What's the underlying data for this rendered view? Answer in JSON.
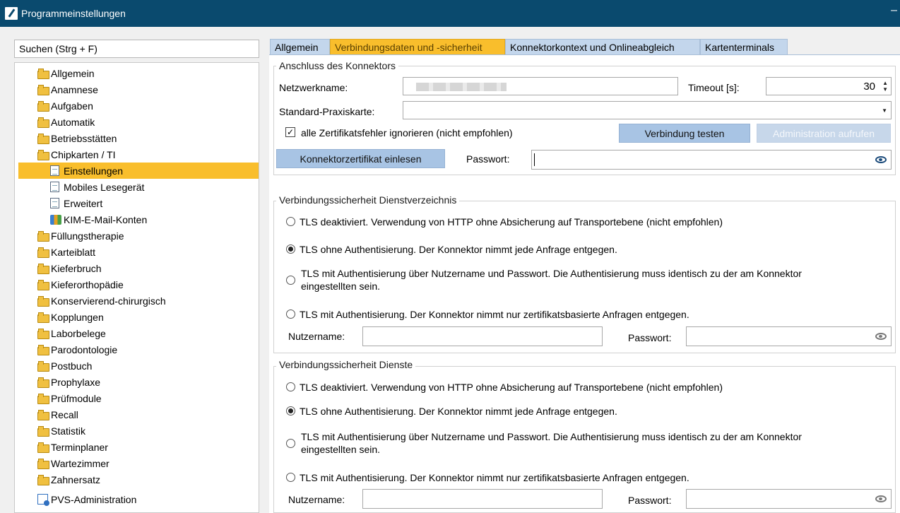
{
  "window": {
    "title": "Programmeinstellungen",
    "minimize_glyph": "–"
  },
  "search": {
    "placeholder": "Suchen (Strg + F)"
  },
  "tree": {
    "items": [
      {
        "label": "Allgemein",
        "icon": "folder-icon"
      },
      {
        "label": "Anamnese",
        "icon": "folder-icon"
      },
      {
        "label": "Aufgaben",
        "icon": "folder-icon"
      },
      {
        "label": "Automatik",
        "icon": "folder-icon"
      },
      {
        "label": "Betriebsstätten",
        "icon": "folder-icon"
      },
      {
        "label": "Chipkarten / TI",
        "icon": "folder-icon"
      },
      {
        "label": "Einstellungen",
        "icon": "document-icon",
        "selected": true
      },
      {
        "label": "Mobiles Lesegerät",
        "icon": "document-icon"
      },
      {
        "label": "Erweitert",
        "icon": "document-icon"
      },
      {
        "label": "KIM-E-Mail-Konten",
        "icon": "books-icon"
      },
      {
        "label": "Füllungstherapie",
        "icon": "folder-icon"
      },
      {
        "label": "Karteiblatt",
        "icon": "folder-icon"
      },
      {
        "label": "Kieferbruch",
        "icon": "folder-icon"
      },
      {
        "label": "Kieferorthopädie",
        "icon": "folder-icon"
      },
      {
        "label": "Konservierend-chirurgisch",
        "icon": "folder-icon"
      },
      {
        "label": "Kopplungen",
        "icon": "folder-icon"
      },
      {
        "label": "Laborbelege",
        "icon": "folder-icon"
      },
      {
        "label": "Parodontologie",
        "icon": "folder-icon"
      },
      {
        "label": "Postbuch",
        "icon": "folder-icon"
      },
      {
        "label": "Prophylaxe",
        "icon": "folder-icon"
      },
      {
        "label": "Prüfmodule",
        "icon": "folder-icon"
      },
      {
        "label": "Recall",
        "icon": "folder-icon"
      },
      {
        "label": "Statistik",
        "icon": "folder-icon"
      },
      {
        "label": "Terminplaner",
        "icon": "folder-icon"
      },
      {
        "label": "Wartezimmer",
        "icon": "folder-icon"
      },
      {
        "label": "Zahnersatz",
        "icon": "folder-icon"
      },
      {
        "label": "PVS-Administration",
        "icon": "pvs-icon"
      }
    ]
  },
  "tabs": [
    {
      "label": "Allgemein"
    },
    {
      "label": "Verbindungsdaten und -sicherheit",
      "active": true
    },
    {
      "label": "Konnektorkontext und Onlineabgleich"
    },
    {
      "label": "Kartenterminals"
    }
  ],
  "konnektor": {
    "title": "Anschluss des Konnektors",
    "netzwerkname_label": "Netzwerkname:",
    "timeout_label": "Timeout [s]:",
    "timeout_value": "30",
    "praxiskarte_label": "Standard-Praxiskarte:",
    "ignore_cert_label": "alle Zertifikatsfehler ignorieren (nicht empfohlen)",
    "ignore_cert_checked": true,
    "test_button": "Verbindung testen",
    "admin_button": "Administration aufrufen",
    "cert_button": "Konnektorzertifikat einlesen",
    "password_label": "Passwort:"
  },
  "dienstverzeichnis": {
    "title": "Verbindungssicherheit Dienstverzeichnis",
    "options": [
      "TLS deaktiviert. Verwendung von HTTP ohne Absicherung auf Transportebene (nicht empfohlen)",
      "TLS ohne Authentisierung. Der Konnektor nimmt jede Anfrage entgegen.",
      "TLS mit Authentisierung über Nutzername und Passwort. Die Authentisierung muss identisch zu der am Konnektor",
      "eingestellten sein.",
      "TLS mit Authentisierung. Der Konnektor nimmt nur zertifikatsbasierte Anfragen entgegen."
    ],
    "selected_index": 1,
    "username_label": "Nutzername:",
    "password_label": "Passwort:"
  },
  "dienste": {
    "title": "Verbindungssicherheit Dienste",
    "options": [
      "TLS deaktiviert. Verwendung von HTTP ohne Absicherung auf Transportebene (nicht empfohlen)",
      "TLS ohne Authentisierung. Der Konnektor nimmt jede Anfrage entgegen.",
      "TLS mit Authentisierung über Nutzername und Passwort. Die Authentisierung muss identisch zu der am Konnektor",
      "eingestellten sein.",
      "TLS mit Authentisierung. Der Konnektor nimmt nur zertifikatsbasierte Anfragen entgegen."
    ],
    "selected_index": 1,
    "username_label": "Nutzername:",
    "password_label": "Passwort:"
  }
}
